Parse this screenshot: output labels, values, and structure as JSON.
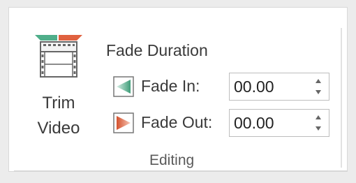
{
  "trim_button": {
    "label_line1": "Trim",
    "label_line2": "Video",
    "icon": "film-trim-icon",
    "colors": {
      "green": "#4fae8a",
      "red": "#e0613f",
      "frame": "#666666"
    }
  },
  "fade_duration": {
    "title": "Fade Duration",
    "fade_in": {
      "label": "Fade In:",
      "value": "00.00",
      "icon": "fade-in-icon",
      "color": "#4fae8a"
    },
    "fade_out": {
      "label": "Fade Out:",
      "value": "00.00",
      "icon": "fade-out-icon",
      "color": "#e0613f"
    }
  },
  "group": {
    "label": "Editing"
  }
}
